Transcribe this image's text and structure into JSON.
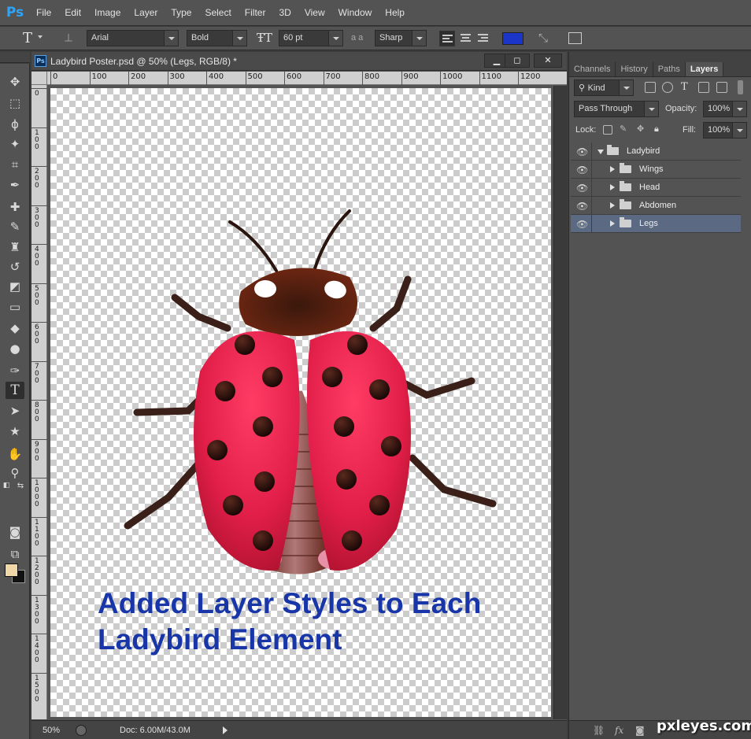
{
  "menubar": {
    "logo": "Ps",
    "items": [
      "File",
      "Edit",
      "Image",
      "Layer",
      "Type",
      "Select",
      "Filter",
      "3D",
      "View",
      "Window",
      "Help"
    ]
  },
  "options": {
    "tool_glyph": "T",
    "font_family": "Arial",
    "font_style": "Bold",
    "font_size": "60 pt",
    "aa_label": "a a",
    "antialias": "Sharp",
    "text_color": "#1a35c8"
  },
  "document": {
    "title": "Ladybird Poster.psd @ 50% (Legs, RGB/8) *",
    "zoom": "50%",
    "doc_size": "Doc: 6.00M/43.0M",
    "hruler_labels": [
      "0",
      "100",
      "200",
      "300",
      "400",
      "500",
      "600",
      "700",
      "800",
      "900",
      "1000",
      "1100",
      "1200"
    ],
    "vruler_labels": [
      "0",
      "100",
      "200",
      "300",
      "400",
      "500",
      "600",
      "700",
      "800",
      "900",
      "1000",
      "1100",
      "1200",
      "1300",
      "1400",
      "1500"
    ],
    "caption_line1": "Added Layer Styles to Each",
    "caption_line2": "Ladybird Element",
    "caption_color": "#1836a8"
  },
  "panel": {
    "tabs": [
      "Channels",
      "History",
      "Paths",
      "Layers"
    ],
    "active_tab": "Layers",
    "kind_label": "Kind",
    "blend_mode": "Pass Through",
    "opacity_label": "Opacity:",
    "opacity_value": "100%",
    "lock_label": "Lock:",
    "fill_label": "Fill:",
    "fill_value": "100%",
    "layers": [
      {
        "name": "Ladybird",
        "expanded": true,
        "indent": 0,
        "selected": false
      },
      {
        "name": "Wings",
        "expanded": false,
        "indent": 1,
        "selected": false
      },
      {
        "name": "Head",
        "expanded": false,
        "indent": 1,
        "selected": false
      },
      {
        "name": "Abdomen",
        "expanded": false,
        "indent": 1,
        "selected": false
      },
      {
        "name": "Legs",
        "expanded": false,
        "indent": 1,
        "selected": true
      }
    ],
    "bottom_icons": [
      "link-icon",
      "fx-icon",
      "mask-icon"
    ],
    "fx_label": "fx"
  },
  "watermark": "pxleyes.com",
  "colors": {
    "foreground": "#f0d8a8",
    "background": "#111111",
    "selection": "#5b6a82"
  }
}
